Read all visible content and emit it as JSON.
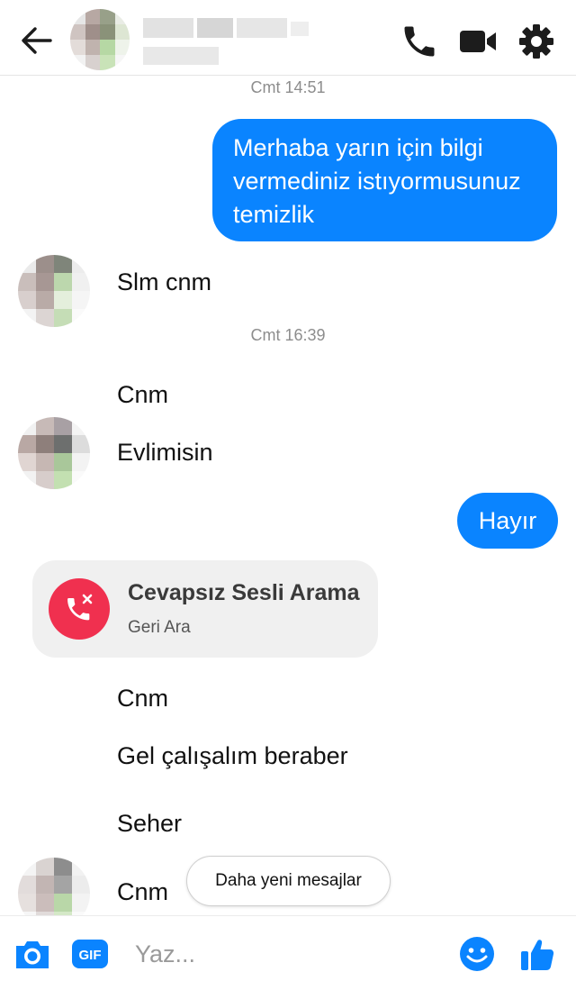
{
  "header": {
    "back_icon": "arrow-left-icon",
    "contact_name": "",
    "actions": [
      {
        "name": "voice-call",
        "icon": "phone-icon"
      },
      {
        "name": "video-call",
        "icon": "video-camera-icon"
      },
      {
        "name": "settings",
        "icon": "gear-icon"
      }
    ]
  },
  "messages": {
    "ts_1": "Cmt 14:51",
    "out_1": "Merhaba yarın için bilgi vermediniz istıyormusunuz temizlik",
    "in_1": "Slm cnm",
    "ts_2": "Cmt 16:39",
    "in_2": "Cnm",
    "in_3": "Evlimisin",
    "out_2": "Hayır",
    "missed_call": {
      "title": "Cevapsız Sesli Arama",
      "subtitle": "Geri Ara",
      "icon": "missed-call-phone-icon"
    },
    "in_4": "Cnm",
    "in_5": "Gel çalışalım beraber",
    "in_6": "Seher",
    "in_7": "Cnm"
  },
  "newer_messages_label": "Daha yeni mesajlar",
  "composer": {
    "placeholder": "Yaz...",
    "icons": [
      "camera-icon",
      "gif-icon",
      "emoji-icon",
      "thumbs-up-icon"
    ]
  },
  "colors": {
    "accent": "#0a84ff",
    "missed_call": "#f0304f",
    "bubble_in": "#f0f0f0",
    "icon_dark": "#1c1c1c"
  }
}
